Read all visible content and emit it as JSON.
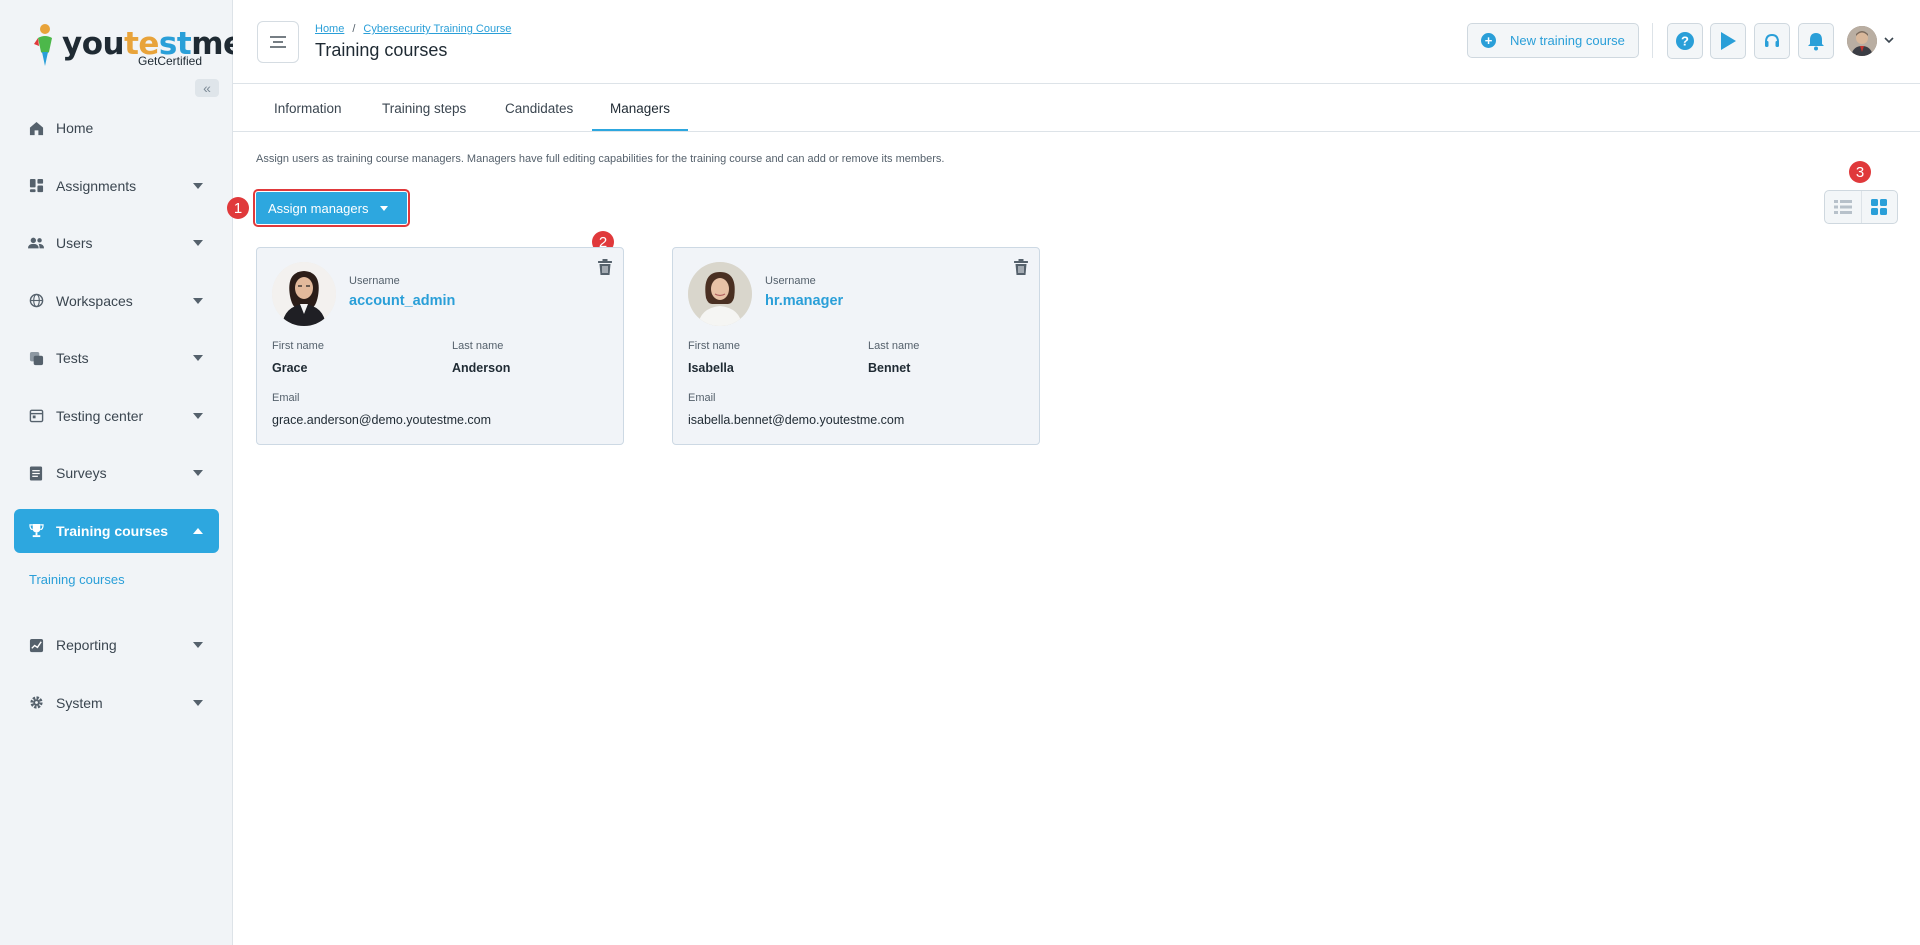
{
  "brand": {
    "logo_parts": [
      "you",
      "te",
      "st",
      "me"
    ],
    "tagline": "GetCertified"
  },
  "sidebar": {
    "items": [
      {
        "label": "Home",
        "icon": "home-icon"
      },
      {
        "label": "Assignments",
        "icon": "dashboard-icon"
      },
      {
        "label": "Users",
        "icon": "users-icon"
      },
      {
        "label": "Workspaces",
        "icon": "globe-icon"
      },
      {
        "label": "Tests",
        "icon": "copy-icon"
      },
      {
        "label": "Testing center",
        "icon": "calendar-icon"
      },
      {
        "label": "Surveys",
        "icon": "list-icon"
      },
      {
        "label": "Training courses",
        "icon": "trophy-icon"
      },
      {
        "label": "Reporting",
        "icon": "chart-icon"
      },
      {
        "label": "System",
        "icon": "gear-icon"
      }
    ],
    "sub_item": "Training courses"
  },
  "header": {
    "breadcrumb": [
      "Home",
      "Cybersecurity Training Course"
    ],
    "title": "Training courses",
    "new_button": "New training course"
  },
  "tabs": [
    "Information",
    "Training steps",
    "Candidates",
    "Managers"
  ],
  "active_tab": "Managers",
  "description": "Assign users as training course managers. Managers have full editing capabilities for the training course and can add or remove its members.",
  "assign_button": "Assign managers",
  "markers": [
    "1",
    "2",
    "3"
  ],
  "labels": {
    "username": "Username",
    "first_name": "First name",
    "last_name": "Last name",
    "email": "Email"
  },
  "managers": [
    {
      "username": "account_admin",
      "first_name": "Grace",
      "last_name": "Anderson",
      "email": "grace.anderson@demo.youtestme.com"
    },
    {
      "username": "hr.manager",
      "first_name": "Isabella",
      "last_name": "Bennet",
      "email": "isabella.bennet@demo.youtestme.com"
    }
  ],
  "colors": {
    "accent": "#2da7df",
    "marker": "#e0393b"
  }
}
